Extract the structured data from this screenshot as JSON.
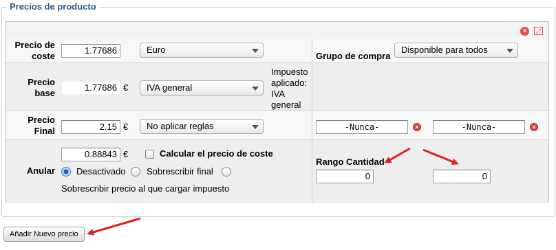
{
  "section": {
    "title": "Precios de producto"
  },
  "rows": {
    "cost": {
      "label": "Precio de coste",
      "value": "1.77686",
      "currency": "Euro",
      "group_label": "Grupo de compra",
      "group_value": "Disponible para todos"
    },
    "base": {
      "label": "Precio base",
      "value": "1.77686",
      "currency_symbol": "€",
      "tax": "IVA general",
      "tax_note": "Impuesto aplicado: IVA general"
    },
    "final": {
      "label": "Precio Final",
      "value": "2.15",
      "currency_symbol": "€",
      "rule": "No aplicar reglas",
      "date_from": "-Nunca-",
      "date_to": "-Nunca-"
    },
    "override": {
      "label": "Anular",
      "value": "0.88843",
      "currency_symbol": "€",
      "calc_cost_label": "Calcular el precio de coste",
      "radio_off_label": "Desactivado",
      "radio_final_label": "Sobrescribir final",
      "tax_price_label": "Sobrescribir precio al que cargar impuesto",
      "range_label": "Rango Cantidad",
      "range_from": "0",
      "range_to": "0"
    }
  },
  "add_button": {
    "label": "Añadir Nuevo precio"
  },
  "colors": {
    "legend": "#2b5b84",
    "annotation_arrow": "#e02020",
    "delete_icon": "#d64545"
  },
  "icons": [
    "remove-icon",
    "fullscreen-icon",
    "delete-date-icon",
    "dropdown-arrow-icon"
  ]
}
